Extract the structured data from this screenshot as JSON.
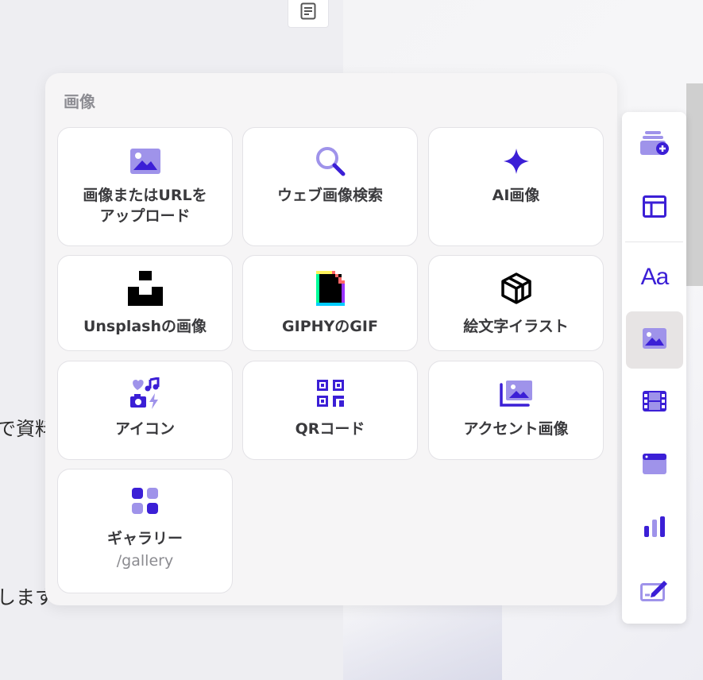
{
  "background": {
    "text_fragment_1": "で資料",
    "text_fragment_2": "します"
  },
  "panel": {
    "title": "画像",
    "items": [
      {
        "label": "画像またはURLを\nアップロード",
        "icon": "image-icon"
      },
      {
        "label": "ウェブ画像検索",
        "icon": "search-icon"
      },
      {
        "label": "AI画像",
        "icon": "sparkle-icon"
      },
      {
        "label": "Unsplashの画像",
        "icon": "unsplash-icon"
      },
      {
        "label": "GIPHYのGIF",
        "icon": "giphy-icon"
      },
      {
        "label": "絵文字イラスト",
        "icon": "openpeeps-icon"
      },
      {
        "label": "アイコン",
        "icon": "icons-icon"
      },
      {
        "label": "QRコード",
        "icon": "qr-code-icon"
      },
      {
        "label": "アクセント画像",
        "icon": "accent-image-icon"
      },
      {
        "label": "ギャラリー",
        "sub": "/gallery",
        "icon": "gallery-icon"
      }
    ]
  },
  "toolbar": {
    "items": [
      {
        "name": "add-card-icon"
      },
      {
        "name": "layout-icon"
      },
      {
        "name": "text-icon",
        "text": "Aa"
      },
      {
        "name": "image-icon",
        "active": true
      },
      {
        "name": "video-icon"
      },
      {
        "name": "embed-icon"
      },
      {
        "name": "chart-icon"
      },
      {
        "name": "form-icon"
      }
    ]
  },
  "colors": {
    "accent": "#3b1fd6",
    "accent_light": "#9f93ea",
    "card_bg": "#ffffff",
    "panel_bg": "#f6f5f6",
    "label": "#3a3a3d",
    "muted": "#8b8b90"
  }
}
